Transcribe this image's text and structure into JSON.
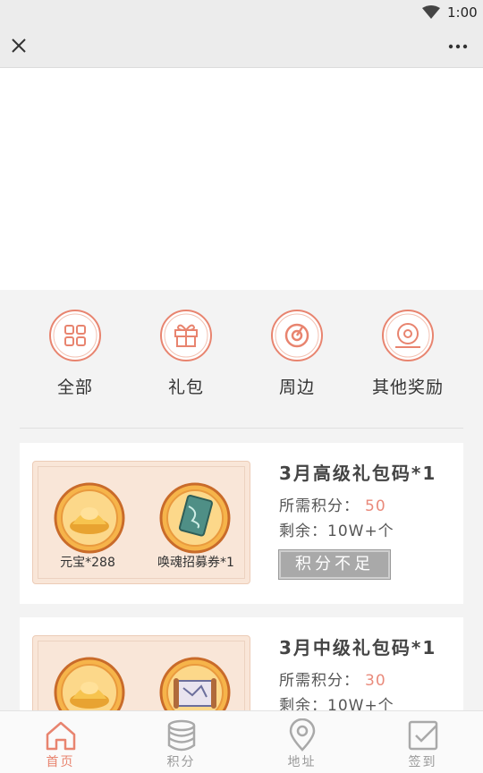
{
  "status": {
    "time": "1:00"
  },
  "categories": [
    {
      "label": "全部",
      "icon": "grid-icon"
    },
    {
      "label": "礼包",
      "icon": "gift-icon"
    },
    {
      "label": "周边",
      "icon": "target-icon"
    },
    {
      "label": "其他奖励",
      "icon": "medal-icon"
    }
  ],
  "products": [
    {
      "title": "3月高级礼包码*1",
      "points_label": "所需积分：",
      "points": "50",
      "stock_label": "剩余：",
      "stock": "10W+个",
      "item1": "元宝*288",
      "item2": "唤魂招募券*1",
      "button": "积分不足"
    },
    {
      "title": "3月中级礼包码*1",
      "points_label": "所需积分：",
      "points": "30",
      "stock_label": "剩余：",
      "stock": "10W+个"
    }
  ],
  "tabs": [
    {
      "label": "首页",
      "icon": "home-icon"
    },
    {
      "label": "积分",
      "icon": "coins-icon"
    },
    {
      "label": "地址",
      "icon": "location-icon"
    },
    {
      "label": "签到",
      "icon": "checkin-icon"
    }
  ],
  "colors": {
    "accent": "#e8846f",
    "points": "#e98a7b",
    "disabled_button": "#a9a9a9"
  }
}
